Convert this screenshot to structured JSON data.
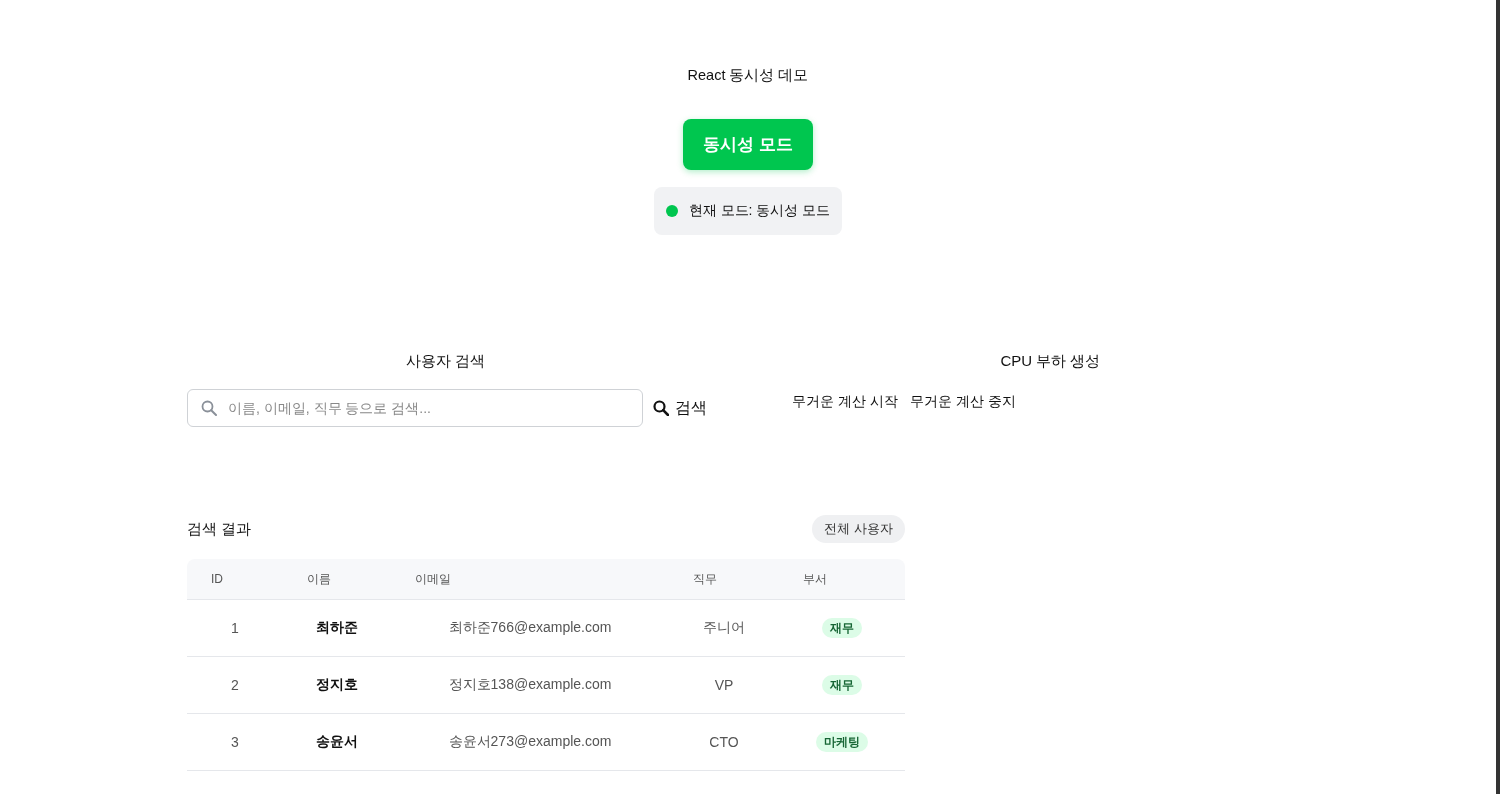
{
  "title": "React 동시성 데모",
  "mode_button": {
    "label": "동시성 모드"
  },
  "mode_status": {
    "label": "현재 모드: 동시성 모드"
  },
  "search": {
    "title": "사용자 검색",
    "placeholder": "이름, 이메일, 직무 등으로 검색...",
    "button": "검색"
  },
  "cpu_load": {
    "title": "CPU 부하 생성",
    "buttons": [
      "무거운 계산 시작",
      "무거운 계산 중지"
    ]
  },
  "results": {
    "title": "검색 결과",
    "filter_button": "전체 사용자",
    "table": {
      "columns": [
        "ID",
        "이름",
        "이메일",
        "직무",
        "부서"
      ],
      "rows": [
        {
          "id": "1",
          "name": "최하준",
          "email": "최하준766@example.com",
          "role": "주니어",
          "department": "재무"
        },
        {
          "id": "2",
          "name": "정지호",
          "email": "정지호138@example.com",
          "role": "VP",
          "department": "재무"
        },
        {
          "id": "3",
          "name": "송윤서",
          "email": "송윤서273@example.com",
          "role": "CTO",
          "department": "마케팅"
        }
      ]
    }
  }
}
